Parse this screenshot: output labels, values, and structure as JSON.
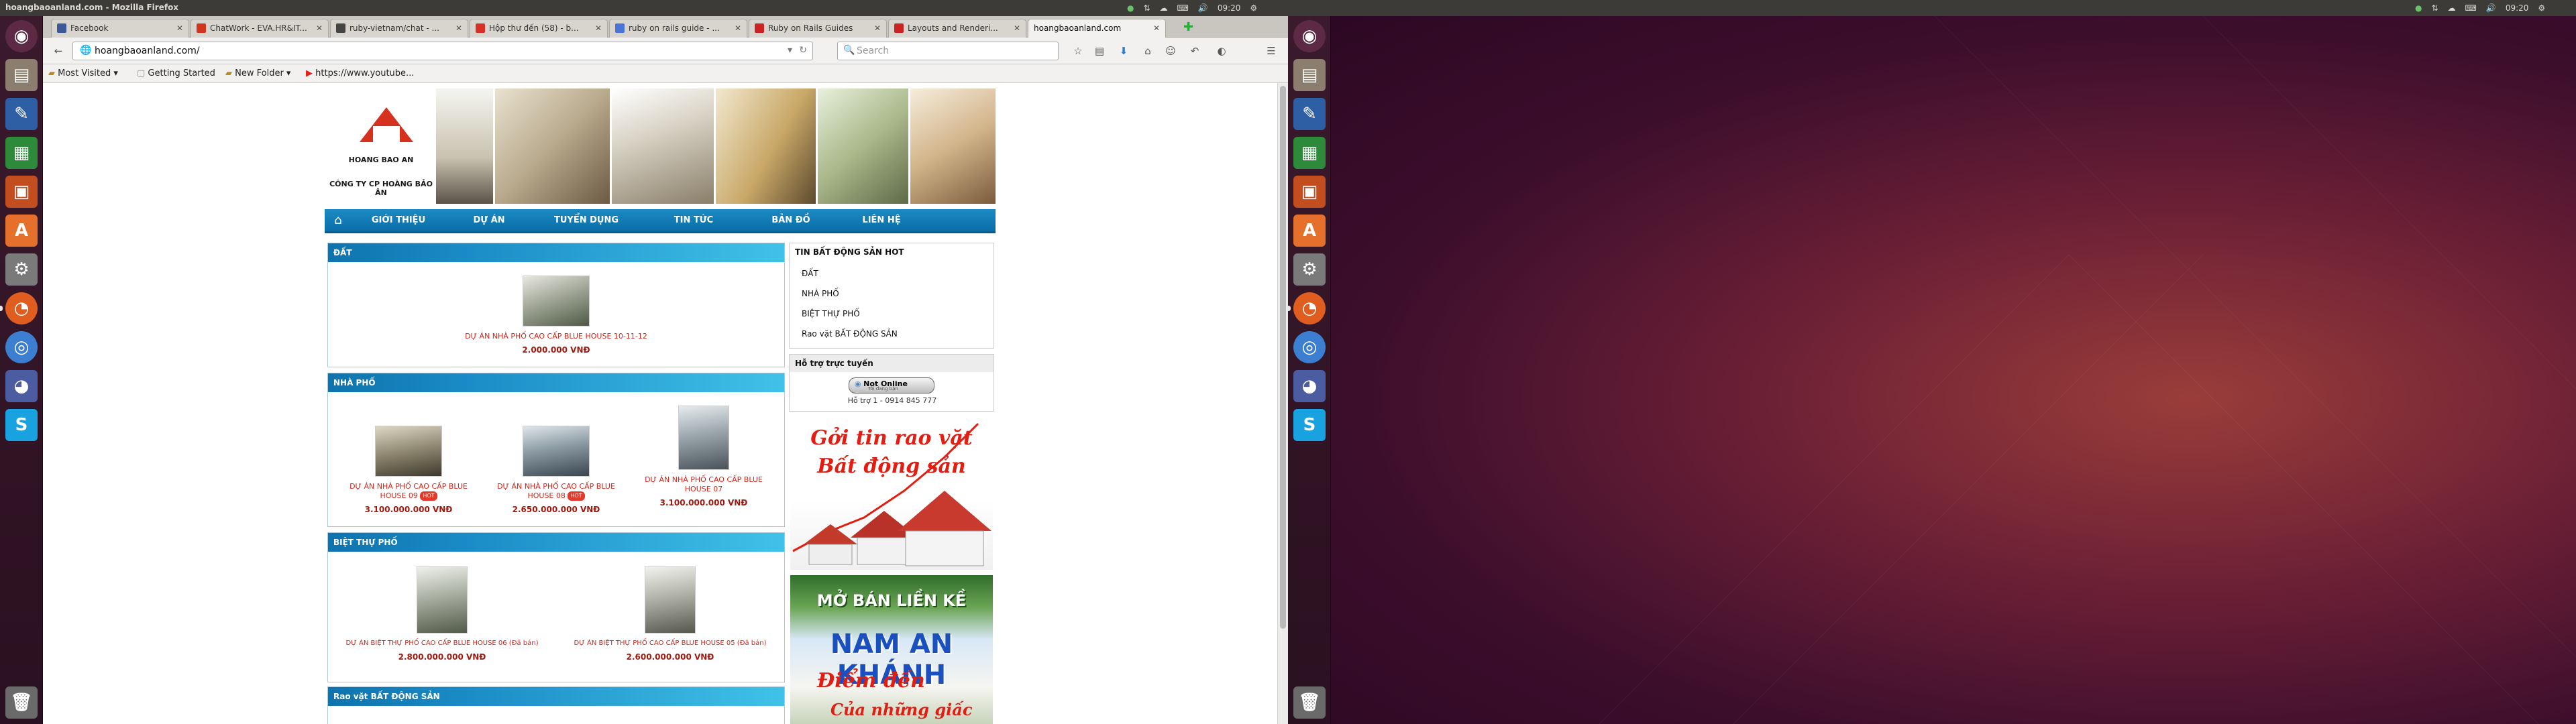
{
  "window": {
    "title": "hoangbaoanland.com - Mozilla Firefox"
  },
  "tray": {
    "time": "09:20"
  },
  "tabs": [
    {
      "label": "Facebook",
      "color": "#3b5998"
    },
    {
      "label": "ChatWork - EVA.HR&IT...",
      "color": "#d2351e"
    },
    {
      "label": "ruby-vietnam/chat - ...",
      "color": "#444444"
    },
    {
      "label": "Hộp thư đến (58) - b...",
      "color": "#d93025"
    },
    {
      "label": "ruby on rails guide - ...",
      "color": "#4a74d8"
    },
    {
      "label": "Ruby on Rails Guides",
      "color": "#cc2222"
    },
    {
      "label": "Layouts and Renderi...",
      "color": "#cc2222"
    },
    {
      "label": "hoangbaoanland.com",
      "color": "#cccccc"
    }
  ],
  "nav": {
    "url": "hoangbaoanland.com/",
    "search_placeholder": "Search"
  },
  "bookmarks": [
    {
      "label": "Most Visited ▾"
    },
    {
      "label": "Getting Started"
    },
    {
      "label": "New Folder ▾"
    },
    {
      "label": "https://www.youtube..."
    }
  ],
  "site": {
    "logo_name": "HOANG BAO AN",
    "logo_company": "CÔNG TY CP HOÀNG BẢO ÂN",
    "menu": [
      "GIỚI THIỆU",
      "DỰ ÁN",
      "TUYỂN DỤNG",
      "TIN TỨC",
      "BẢN ĐỒ",
      "LIÊN HỆ"
    ],
    "sections": {
      "dat": {
        "title": "ĐẤT",
        "items": [
          {
            "name": "DỰ ÁN NHÀ PHỐ CAO CẤP BLUE HOUSE 10-11-12",
            "price": "2.000.000 VNĐ"
          }
        ]
      },
      "nhapho": {
        "title": "NHÀ PHỐ",
        "items": [
          {
            "name1": "DỰ ÁN NHÀ PHỐ CAO CẤP BLUE",
            "name2": "HOUSE 09",
            "price": "3.100.000.000 VNĐ",
            "hot": true
          },
          {
            "name1": "DỰ ÁN NHÀ PHỐ CAO CẤP BLUE",
            "name2": "HOUSE 08",
            "price": "2.650.000.000 VNĐ",
            "hot": true
          },
          {
            "name1": "DỰ ÁN NHÀ PHỐ CAO CẤP BLUE",
            "name2": "HOUSE 07",
            "price": "3.100.000.000 VNĐ",
            "hot": false
          }
        ]
      },
      "bietthu": {
        "title": "BIỆT THỰ PHỐ",
        "items": [
          {
            "name": "DỰ ÁN BIỆT THỰ PHỐ CAO CẤP BLUE HOUSE 06 (Đã bán)",
            "price": "2.800.000.000 VNĐ"
          },
          {
            "name": "DỰ ÁN BIỆT THỰ PHỐ CAO CẤP BLUE HOUSE 05 (Đã bán)",
            "price": "2.600.000.000 VNĐ"
          }
        ]
      },
      "raovat": {
        "title": "Rao vặt BẤT ĐỘNG SẢN"
      }
    },
    "hot_badge": "HOT",
    "sidebar": {
      "hot_title": "TIN BẤT ĐỘNG SẢN HOT",
      "hot_links": [
        "ĐẤT",
        "NHÀ PHỐ",
        "BIỆT THỰ PHỐ",
        "Rao vặt BẤT ĐỘNG SẢN"
      ],
      "support_title": "Hỗ trợ trực tuyến",
      "status_label": "Not Online",
      "status_sub": "Tôi đang bận",
      "support_contact": "Hỗ trợ 1 - 0914 845 777",
      "banner1_line1": "Gởi tin rao vặt",
      "banner1_line2": "Bất động sản",
      "banner2_line1": "MỞ BÁN LIỀN KỀ",
      "banner2_line2": "NAM AN KHÁNH",
      "banner2_line3": "Điểm đến",
      "banner2_line4": "Của những giấc mơ"
    }
  },
  "launcher_icons": [
    "dash-icon",
    "files-icon",
    "writer-icon",
    "calc-icon",
    "impress-icon",
    "software-center-icon",
    "settings-icon",
    "firefox-icon",
    "chromium-icon",
    "pidgin-icon",
    "skype-icon",
    "trash-icon"
  ]
}
